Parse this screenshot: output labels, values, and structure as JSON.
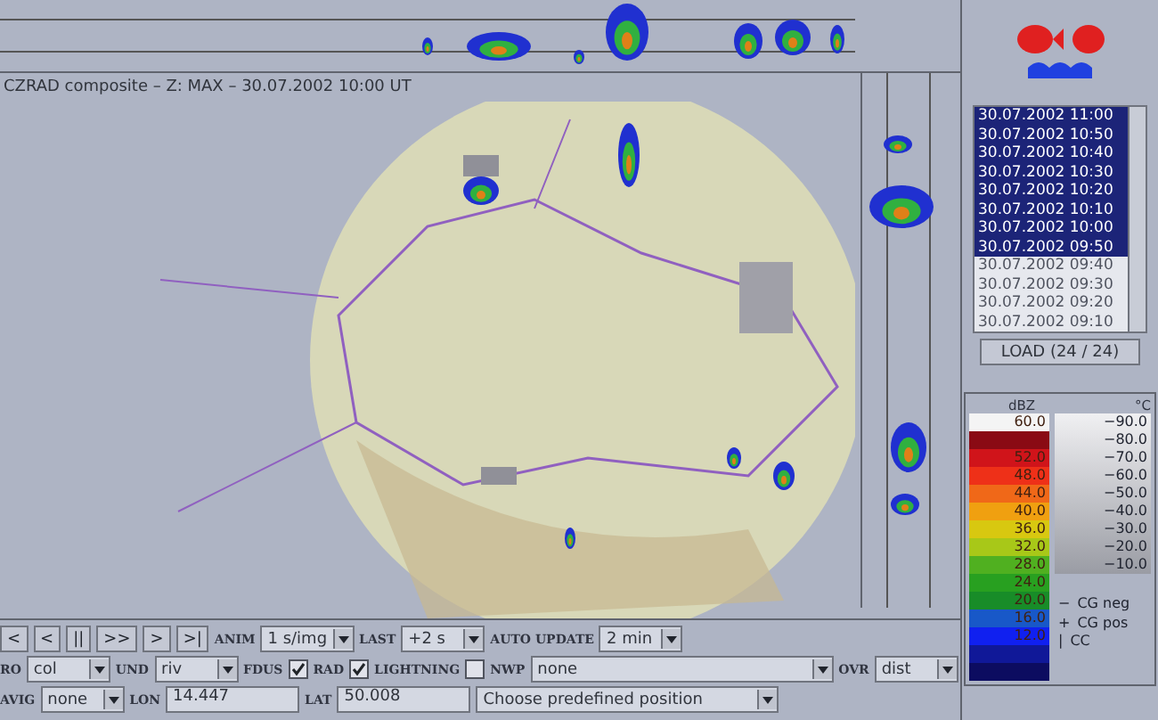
{
  "map": {
    "caption": "CZRAD composite – Z: MAX – 30.07.2002 10:00 UT"
  },
  "times": [
    {
      "label": "30.07.2002 11:00",
      "selected": true
    },
    {
      "label": "30.07.2002 10:50",
      "selected": true
    },
    {
      "label": "30.07.2002 10:40",
      "selected": true
    },
    {
      "label": "30.07.2002 10:30",
      "selected": true
    },
    {
      "label": "30.07.2002 10:20",
      "selected": true
    },
    {
      "label": "30.07.2002 10:10",
      "selected": true
    },
    {
      "label": "30.07.2002 10:00",
      "selected": true
    },
    {
      "label": "30.07.2002 09:50",
      "selected": true
    },
    {
      "label": "30.07.2002 09:40",
      "selected": false
    },
    {
      "label": "30.07.2002 09:30",
      "selected": false
    },
    {
      "label": "30.07.2002 09:20",
      "selected": false
    },
    {
      "label": "30.07.2002 09:10",
      "selected": false
    }
  ],
  "load_button": "LOAD (24 / 24)",
  "legend": {
    "dbz_title": "dBZ",
    "temp_title": "°C",
    "dbz": [
      {
        "label": "60.0",
        "color": "#f4f4f4"
      },
      {
        "color": "#8a0a14"
      },
      {
        "label": "52.0",
        "color": "#d0141a"
      },
      {
        "label": "48.0",
        "color": "#ee3018"
      },
      {
        "label": "44.0",
        "color": "#f06818"
      },
      {
        "label": "40.0",
        "color": "#f0a010"
      },
      {
        "label": "36.0",
        "color": "#d8c810"
      },
      {
        "label": "32.0",
        "color": "#a8c818"
      },
      {
        "label": "28.0",
        "color": "#50b020"
      },
      {
        "label": "24.0",
        "color": "#28a020"
      },
      {
        "label": "20.0",
        "color": "#188c28"
      },
      {
        "label": "16.0",
        "color": "#1858c8"
      },
      {
        "label": "12.0",
        "color": "#1020f0"
      },
      {
        "color": "#101898"
      },
      {
        "color": "#0c0c60"
      }
    ],
    "temps": [
      "−90.0",
      "−80.0",
      "−70.0",
      "−60.0",
      "−50.0",
      "−40.0",
      "−30.0",
      "−20.0",
      "−10.0"
    ],
    "lightning": [
      {
        "symbol": "−",
        "label": "CG neg"
      },
      {
        "symbol": "+",
        "label": "CG pos"
      },
      {
        "symbol": "|",
        "label": "CC"
      }
    ]
  },
  "controls": [
    [
      {
        "kind": "button",
        "label": "<"
      },
      {
        "kind": "button",
        "label": "<"
      },
      {
        "kind": "button",
        "label": "||"
      },
      {
        "kind": "button",
        "label": ">>"
      },
      {
        "kind": "button",
        "label": ">"
      },
      {
        "kind": "button",
        "label": ">|"
      },
      {
        "kind": "label",
        "label": "ANIM"
      },
      {
        "kind": "select",
        "value": "1 s/img"
      },
      {
        "kind": "label",
        "label": "LAST"
      },
      {
        "kind": "select",
        "value": "+2 s"
      },
      {
        "kind": "label",
        "label": "AUTO UPDATE"
      },
      {
        "kind": "select",
        "value": "2 min"
      }
    ],
    [
      {
        "kind": "label",
        "label": "RO"
      },
      {
        "kind": "select",
        "value": "col"
      },
      {
        "kind": "label",
        "label": "UND"
      },
      {
        "kind": "select",
        "value": "riv"
      },
      {
        "kind": "label",
        "label": "FDUS"
      },
      {
        "kind": "checkbox",
        "checked": true
      },
      {
        "kind": "label",
        "label": "RAD"
      },
      {
        "kind": "checkbox",
        "checked": true
      },
      {
        "kind": "label",
        "label": "LIGHTNING"
      },
      {
        "kind": "checkbox",
        "checked": false
      },
      {
        "kind": "label",
        "label": "NWP"
      },
      {
        "kind": "select",
        "value": "none",
        "wide": true
      },
      {
        "kind": "label",
        "label": "OVR"
      },
      {
        "kind": "select",
        "value": "dist"
      }
    ],
    [
      {
        "kind": "label",
        "label": "AVIG"
      },
      {
        "kind": "select",
        "value": "none"
      },
      {
        "kind": "label",
        "label": "LON"
      },
      {
        "kind": "field",
        "value": "14.447"
      },
      {
        "kind": "label",
        "label": "LAT"
      },
      {
        "kind": "field",
        "value": "50.008"
      },
      {
        "kind": "select",
        "value": "Choose predefined position",
        "wide": true
      }
    ]
  ]
}
